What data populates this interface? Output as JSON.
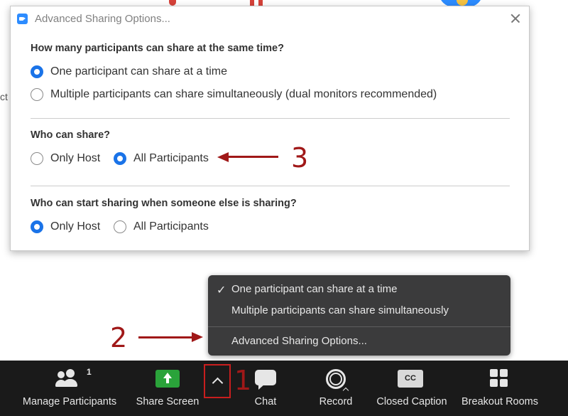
{
  "dialog": {
    "title": "Advanced Sharing Options...",
    "sections": [
      {
        "question": "How many participants can share at the same time?",
        "options": [
          {
            "label": "One participant can share at a time",
            "selected": true
          },
          {
            "label": "Multiple participants can share simultaneously (dual monitors recommended)",
            "selected": false
          }
        ]
      },
      {
        "question": "Who can share?",
        "options": [
          {
            "label": "Only Host",
            "selected": false
          },
          {
            "label": "All Participants",
            "selected": true
          }
        ]
      },
      {
        "question": "Who can start sharing when someone else is sharing?",
        "options": [
          {
            "label": "Only Host",
            "selected": true
          },
          {
            "label": "All Participants",
            "selected": false
          }
        ]
      }
    ]
  },
  "background_fragment_text": "ct",
  "menu": {
    "items": [
      {
        "label": "One participant can share at a time",
        "checked": true
      },
      {
        "label": "Multiple participants can share simultaneously",
        "checked": false
      },
      {
        "label": "Advanced Sharing Options...",
        "checked": false
      }
    ],
    "check_glyph": "✓"
  },
  "annotations": {
    "one": "1",
    "two": "2",
    "three": "3",
    "color": "#a01818"
  },
  "toolbar": {
    "participant_count": "1",
    "items": [
      {
        "label": "Manage Participants",
        "icon": "participants-icon"
      },
      {
        "label": "Share Screen",
        "icon": "share-screen-icon"
      },
      {
        "label": "Chat",
        "icon": "chat-icon"
      },
      {
        "label": "Record",
        "icon": "record-icon"
      },
      {
        "label": "Closed Caption",
        "icon": "closed-caption-icon",
        "icon_text": "CC"
      },
      {
        "label": "Breakout Rooms",
        "icon": "breakout-rooms-icon"
      }
    ]
  },
  "colors": {
    "radio_selected": "#1a73e8",
    "share_green": "#2aa33a",
    "toolbar_bg": "#1a1a1a",
    "menu_bg": "#3b3b3c",
    "highlight_box": "#c81e1e"
  }
}
